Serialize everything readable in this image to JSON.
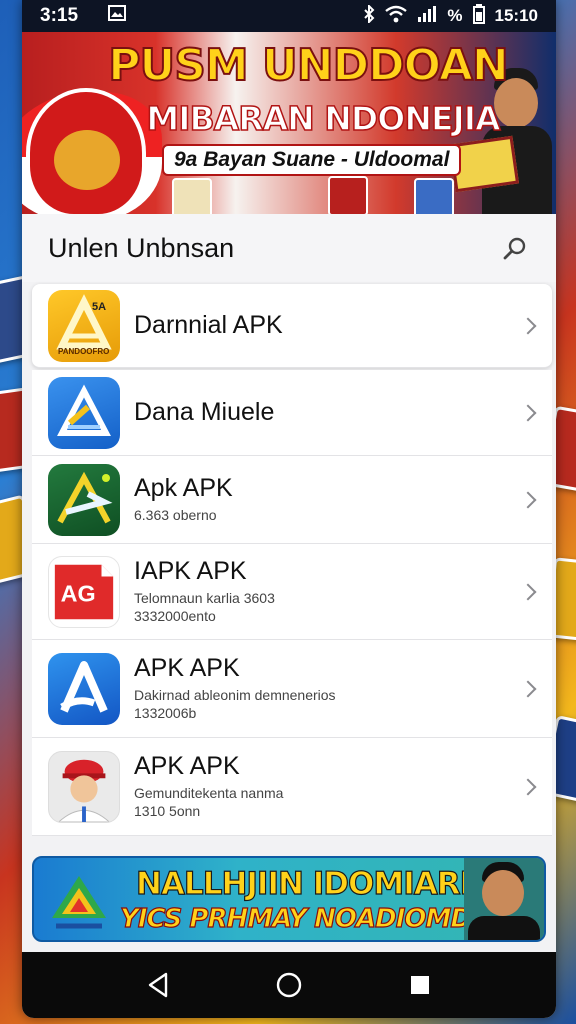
{
  "status_bar": {
    "time": "3:15",
    "battery_text": "%",
    "right_time": "15:10"
  },
  "banner": {
    "title": "PUSM UNDDOAN",
    "subtitle": "MIBARAN NDONEJIA",
    "tagline": "9a Bayan Suane - Uldoomal"
  },
  "header": {
    "title": "Unlen Unbnsan"
  },
  "apps": [
    {
      "name": "Darnnial APK",
      "meta": "",
      "icon": "yellow-triangle-icon",
      "icon_badge": "5A",
      "icon_caption": "PANDOOFRO",
      "color": "#f5b516"
    },
    {
      "name": "Dana Miuele",
      "meta": "",
      "icon": "blue-triangle-icon",
      "color": "#1f7be0"
    },
    {
      "name": "Apk APK",
      "meta": "6.363 oberno",
      "icon": "green-arrow-icon",
      "color": "#1a6a35"
    },
    {
      "name": "IAPK APK",
      "meta": "Telomnaun karlia 3603\n3332000ento",
      "icon": "red-page-icon",
      "icon_text": "AG",
      "color": "#e02a2a"
    },
    {
      "name": "APK APK",
      "meta": "Dakirnad ableonim demnenerios\n1332006b",
      "icon": "blue-a-icon",
      "color": "#1f6ed8"
    },
    {
      "name": "APK APK",
      "meta": "Gemunditekenta nanma\n1310 5onn",
      "icon": "boy-avatar-icon",
      "color": "#ececec"
    }
  ],
  "footer_ad": {
    "line1": "NALLHJIIN IDOMIARD",
    "line2": "YICS PRHMAY NOADIOMDO!!"
  },
  "nav": {
    "back": "back-icon",
    "home": "home-icon",
    "recent": "recent-apps-icon"
  },
  "colors": {
    "accent_blue": "#1f7be0",
    "brand_red": "#d11a1a",
    "brand_yellow": "#ffd21a"
  }
}
